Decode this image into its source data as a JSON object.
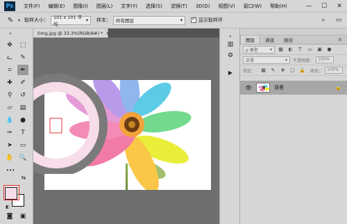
{
  "app": {
    "logo": "Ps",
    "menu": [
      "文件(F)",
      "编辑(E)",
      "图像(I)",
      "图层(L)",
      "文字(Y)",
      "选择(S)",
      "滤镜(T)",
      "3D(D)",
      "视图(V)",
      "窗口(W)",
      "帮助(H)"
    ],
    "window_controls": {
      "minimize": "—",
      "maximize": "☐",
      "close": "✕"
    }
  },
  "options": {
    "tool_glyph": "✎",
    "sample_size_label": "取样大小：",
    "sample_size_value": "101 x 101 平均",
    "sample_label": "样本：",
    "sample_value": "所有图层",
    "show_ring_label": "显示取样环"
  },
  "document": {
    "tab_label": "timg.jpg @ 33.3%(RGB/8#) *",
    "tab_close": "×"
  },
  "colors": {
    "foreground": "#f6dde9",
    "background": "#ffffff",
    "workspace": "#6e6e6e",
    "ring_outer": "#7a7a7a",
    "ring_inner": "#f6dde9"
  },
  "layers_panel": {
    "tabs": [
      "图层",
      "通道",
      "路径"
    ],
    "filter_label": "ρ 类型",
    "blend_mode": "正常",
    "opacity_label": "不透明度：",
    "opacity_value": "100%",
    "lock_label": "锁定：",
    "fill_label": "填充：",
    "fill_value": "100%",
    "layer_name": "背景",
    "layer_lock": "🔒"
  }
}
